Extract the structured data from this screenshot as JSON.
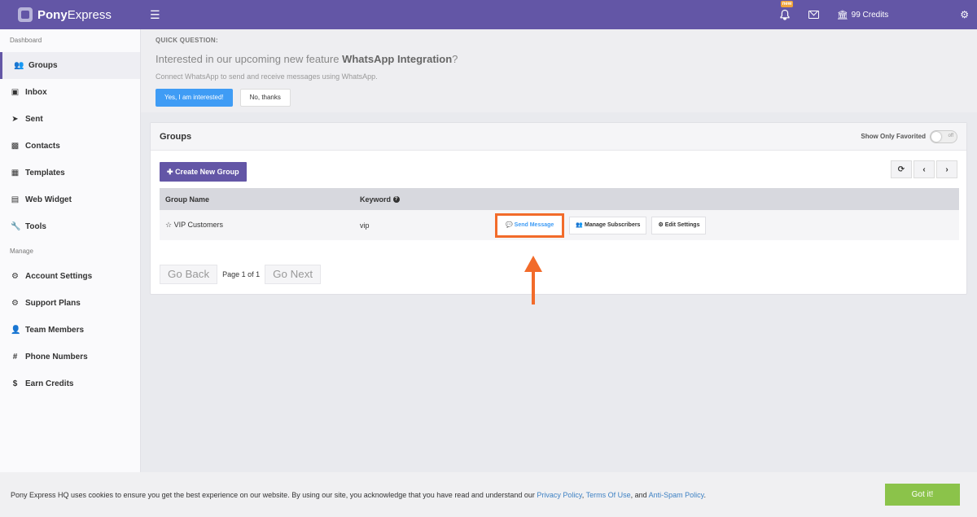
{
  "brand": {
    "name_bold": "Pony",
    "name_rest": "Express"
  },
  "topbar": {
    "menu_icon": "hamburger-icon",
    "new_badge": "new",
    "credits": "99 Credits"
  },
  "sidebar": {
    "sections": [
      {
        "label": "Dashboard"
      },
      {
        "label": "Manage"
      }
    ],
    "dashboard_items": [
      {
        "label": "Groups",
        "icon": "users-icon"
      },
      {
        "label": "Inbox",
        "icon": "inbox-icon"
      },
      {
        "label": "Sent",
        "icon": "paper-plane-icon"
      },
      {
        "label": "Contacts",
        "icon": "address-book-icon"
      },
      {
        "label": "Templates",
        "icon": "grid-icon"
      },
      {
        "label": "Web Widget",
        "icon": "widget-icon"
      },
      {
        "label": "Tools",
        "icon": "wrench-icon"
      }
    ],
    "manage_items": [
      {
        "label": "Account Settings",
        "icon": "gear-icon"
      },
      {
        "label": "Support Plans",
        "icon": "gear-icon"
      },
      {
        "label": "Team Members",
        "icon": "user-plus-icon"
      },
      {
        "label": "Phone Numbers",
        "icon": "hash-icon"
      },
      {
        "label": "Earn Credits",
        "icon": "dollar-icon"
      }
    ]
  },
  "quick": {
    "label": "QUICK QUESTION:",
    "title_pre": "Interested in our upcoming new feature ",
    "title_bold": "WhatsApp Integration",
    "title_post": "?",
    "subtitle": "Connect WhatsApp to send and receive messages using WhatsApp.",
    "yes_label": "Yes, I am interested!",
    "no_label": "No, thanks"
  },
  "groups": {
    "title": "Groups",
    "favorite_label": "Show Only Favorited",
    "toggle_text": "off",
    "create_label": "Create New Group",
    "columns": [
      "Group Name",
      "Keyword"
    ],
    "rows": [
      {
        "name": "VIP Customers",
        "keyword": "vip"
      }
    ],
    "actions": {
      "send": "Send Message",
      "manage": "Manage Subscribers",
      "edit": "Edit Settings"
    },
    "pager": {
      "back": "Go Back",
      "text": "Page 1 of 1",
      "next": "Go Next"
    }
  },
  "cookie": {
    "text": "Pony Express HQ uses cookies to ensure you get the best experience on our website. By using our site, you acknowledge that you have read and understand our ",
    "privacy": "Privacy Policy",
    "sep1": ", ",
    "terms": "Terms Of Use",
    "sep2": ", and ",
    "antispam": "Anti-Spam Policy",
    "end": ".",
    "button": "Got it!"
  },
  "colors": {
    "brand": "#6356a6",
    "primary": "#3f9cf5",
    "success": "#8bc34a",
    "highlight": "#f26b2a"
  }
}
